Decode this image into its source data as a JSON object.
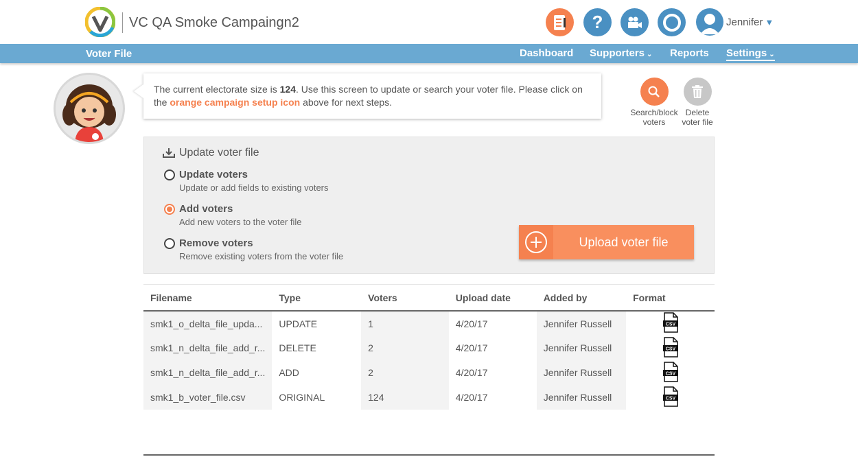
{
  "header": {
    "app_title": "VC QA Smoke Campaingn2",
    "user_name": "Jennifer",
    "icons": [
      "campaign-setup-icon",
      "help-icon",
      "video-icon",
      "circle-icon",
      "user-avatar-icon"
    ]
  },
  "nav": {
    "page_title": "Voter File",
    "items": [
      {
        "label": "Dashboard"
      },
      {
        "label": "Supporters"
      },
      {
        "label": "Reports"
      },
      {
        "label": "Settings"
      }
    ]
  },
  "message": {
    "prefix": "The current electorate size is ",
    "count": "124",
    "middle": ". Use this screen to update or search your voter file. Please click on the ",
    "link": "orange campaign setup icon",
    "suffix": " above for next steps."
  },
  "actions": {
    "search_l1": "Search/block",
    "search_l2": "voters",
    "delete_l1": "Delete",
    "delete_l2": "voter file"
  },
  "update_panel": {
    "title": "Update voter file",
    "options": [
      {
        "label": "Update voters",
        "desc": "Update or add fields to existing voters",
        "selected": false
      },
      {
        "label": "Add voters",
        "desc": "Add new voters to the voter file",
        "selected": true
      },
      {
        "label": "Remove voters",
        "desc": "Remove existing voters from the voter file",
        "selected": false
      }
    ],
    "upload_label": "Upload voter file"
  },
  "table": {
    "headers": [
      "Filename",
      "Type",
      "Voters",
      "Upload date",
      "Added by",
      "Format"
    ],
    "rows": [
      {
        "filename": "smk1_o_delta_file_upda...",
        "type": "UPDATE",
        "voters": "1",
        "date": "4/20/17",
        "added_by": "Jennifer Russell",
        "format": "CSV"
      },
      {
        "filename": "smk1_n_delta_file_add_r...",
        "type": "DELETE",
        "voters": "2",
        "date": "4/20/17",
        "added_by": "Jennifer Russell",
        "format": "CSV"
      },
      {
        "filename": "smk1_n_delta_file_add_r...",
        "type": "ADD",
        "voters": "2",
        "date": "4/20/17",
        "added_by": "Jennifer Russell",
        "format": "CSV"
      },
      {
        "filename": "smk1_b_voter_file.csv",
        "type": "ORIGINAL",
        "voters": "124",
        "date": "4/20/17",
        "added_by": "Jennifer Russell",
        "format": "CSV"
      }
    ]
  },
  "colors": {
    "accent": "#f5814f",
    "nav": "#6aa9d2",
    "icon_blue": "#4a90c2"
  }
}
